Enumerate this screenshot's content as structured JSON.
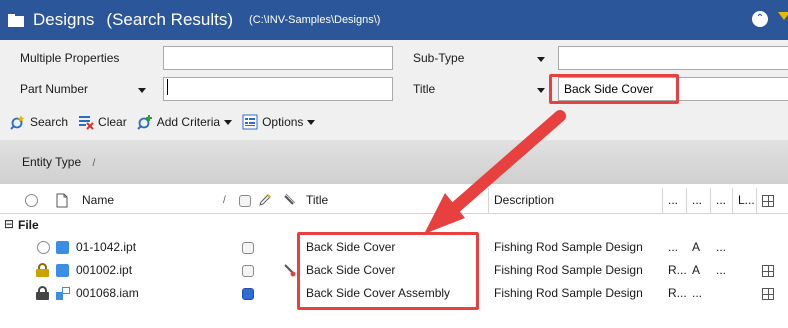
{
  "window": {
    "title": "Designs",
    "subtitle": "(Search Results)",
    "path": "(C:\\INV-Samples\\Designs\\)"
  },
  "search": {
    "multiple_properties_label": "Multiple Properties",
    "multiple_properties_value": "",
    "sub_type_label": "Sub-Type",
    "sub_type_value": "",
    "part_number_label": "Part Number",
    "part_number_value": "",
    "title_label": "Title",
    "title_value": "Back Side Cover"
  },
  "toolbar": {
    "search_label": "Search",
    "clear_label": "Clear",
    "add_criteria_label": "Add Criteria",
    "options_label": "Options"
  },
  "group_by": {
    "label": "Entity Type",
    "sort_glyph": "/"
  },
  "grid": {
    "columns": {
      "name": "Name",
      "name_sort": "/",
      "title": "Title",
      "description": "Description",
      "c1": "...",
      "c2": "...",
      "c3": "...",
      "c4": "L..."
    },
    "group_label": "File",
    "group_toggle": "⊟",
    "rows": [
      {
        "name": "01-1042.ipt",
        "title": "Back Side Cover",
        "description": "Fishing Rod Sample Design",
        "c1": "...",
        "c2": "A",
        "c3": "...",
        "c4": ""
      },
      {
        "name": "001002.ipt",
        "title": "Back Side Cover",
        "description": "Fishing Rod Sample Design",
        "c1": "R...",
        "c2": "A",
        "c3": "...",
        "c4": ""
      },
      {
        "name": "001068.iam",
        "title": "Back Side Cover Assembly",
        "description": "Fishing Rod Sample Design",
        "c1": "R...",
        "c2": "...",
        "c3": "",
        "c4": ""
      }
    ]
  },
  "colors": {
    "title_bar": "#2b579a",
    "highlight": "#e8403f",
    "part_icon": "#3a8ee6"
  }
}
